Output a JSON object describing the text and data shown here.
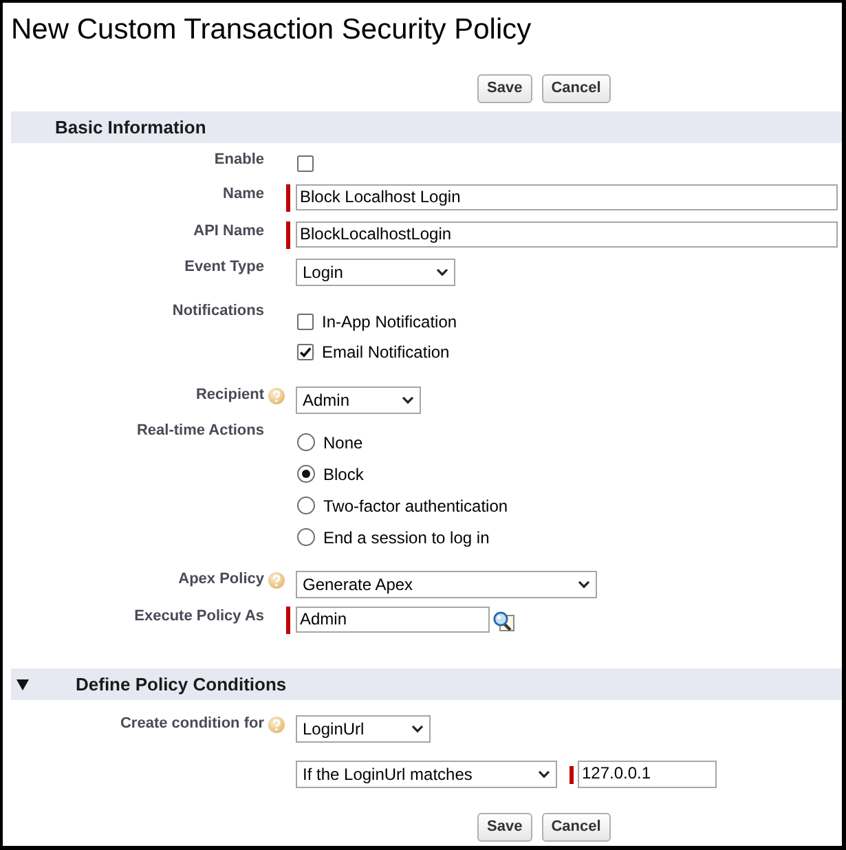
{
  "page": {
    "title": "New Custom Transaction Security Policy"
  },
  "top_buttons": [
    "Save",
    "Cancel"
  ],
  "sections": [
    {
      "title": "Basic Information",
      "fields": [
        {
          "kind": "checkbox",
          "label": "Enable",
          "help": false,
          "required": false,
          "checked": false
        },
        {
          "kind": "text",
          "label": "Name",
          "help": false,
          "required": true,
          "value": "Block Localhost Login"
        },
        {
          "kind": "text",
          "label": "API Name",
          "help": false,
          "required": true,
          "value": "BlockLocalhostLogin"
        },
        {
          "kind": "select",
          "label": "Event Type",
          "help": false,
          "required": false,
          "value": "Login"
        },
        {
          "kind": "checkboxes",
          "label": "Notifications",
          "help": false,
          "required": false,
          "options": [
            {
              "label": "In-App Notification",
              "checked": false
            },
            {
              "label": "Email Notification",
              "checked": true
            }
          ]
        },
        {
          "kind": "select",
          "label": "Recipient",
          "help": true,
          "required": false,
          "value": "Admin"
        },
        {
          "kind": "radios",
          "label": "Real-time Actions",
          "help": false,
          "required": false,
          "options": [
            {
              "label": "None",
              "selected": false
            },
            {
              "label": "Block",
              "selected": true
            },
            {
              "label": "Two-factor authentication",
              "selected": false
            },
            {
              "label": "End a session to log in",
              "selected": false
            }
          ]
        },
        {
          "kind": "select",
          "label": "Apex Policy",
          "help": true,
          "required": false,
          "value": "Generate Apex"
        },
        {
          "kind": "lookup",
          "label": "Execute Policy As",
          "help": false,
          "required": true,
          "value": "Admin"
        }
      ]
    },
    {
      "title": "Define Policy Conditions",
      "expanded": true,
      "fields": [
        {
          "kind": "select",
          "label": "Create condition for",
          "help": true,
          "required": false,
          "value": "LoginUrl"
        },
        {
          "kind": "condition",
          "help": false,
          "required": true,
          "operator": "If the LoginUrl matches",
          "value": "127.0.0.1"
        }
      ]
    }
  ],
  "bottom_buttons": [
    "Save",
    "Cancel"
  ]
}
